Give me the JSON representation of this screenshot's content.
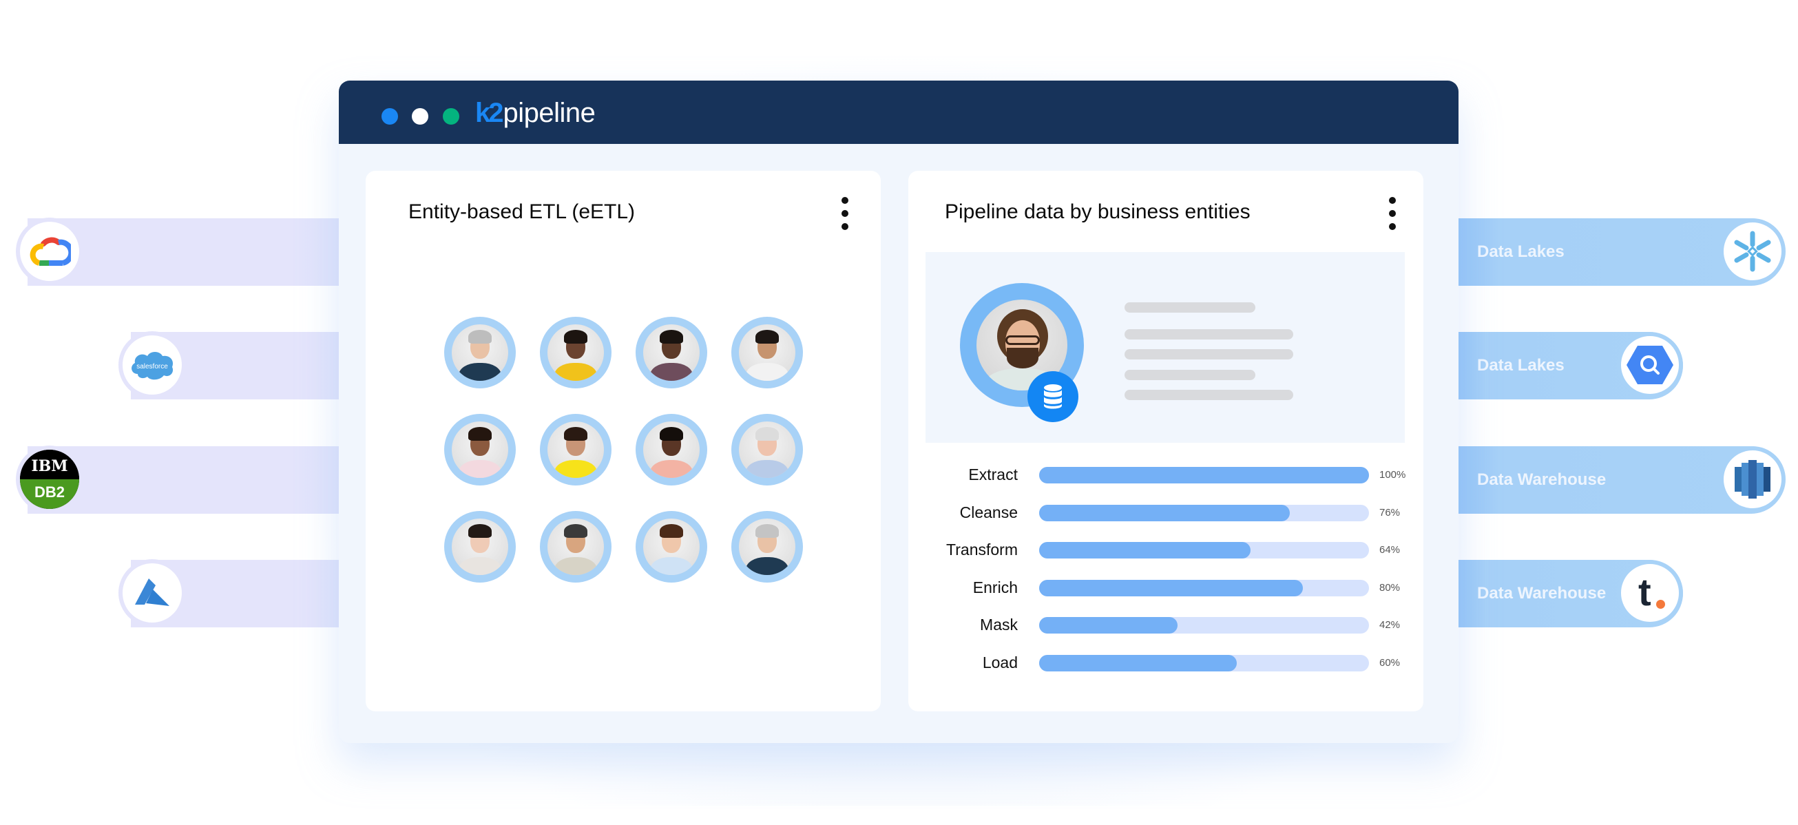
{
  "app": {
    "brand_prefix": "k2",
    "brand_name": "pipeline",
    "window_dots": [
      "blue",
      "white",
      "green"
    ],
    "colors": {
      "header_bg": "#17335a",
      "accent_blue": "#1a87f4",
      "accent_green": "#04b47f",
      "bar_fill": "#74b0f6",
      "bar_track": "#d6e2fd",
      "avatar_ring": "#a8d2f7"
    }
  },
  "sources": [
    {
      "name": "Google Cloud",
      "icon": "google-cloud-icon"
    },
    {
      "name": "Salesforce",
      "icon": "salesforce-icon",
      "logo_text": "salesforce"
    },
    {
      "name": "IBM DB2",
      "icon": "ibm-db2-icon",
      "logo_text_top": "IBM",
      "logo_text_bottom": "DB2"
    },
    {
      "name": "Azure",
      "icon": "azure-icon"
    }
  ],
  "destinations": [
    {
      "label": "Data Lakes",
      "icon": "snowflake-icon"
    },
    {
      "label": "Data Lakes",
      "icon": "bigquery-icon"
    },
    {
      "label": "Data Warehouse",
      "icon": "redshift-icon"
    },
    {
      "label": "Data Warehouse",
      "icon": "teradata-icon",
      "logo_text": "t"
    }
  ],
  "left_panel": {
    "title": "Entity-based ETL (eETL)",
    "menu_icon": "kebab-menu-icon",
    "entities": [
      {
        "name": "entity-1",
        "skin": "#e9c2a6",
        "hair": "#bdbdbd",
        "shirt": "#1f3a52"
      },
      {
        "name": "entity-2",
        "skin": "#6b4330",
        "hair": "#1c1410",
        "shirt": "#f1c21b"
      },
      {
        "name": "entity-3",
        "skin": "#5c3a28",
        "hair": "#1a1410",
        "shirt": "#6e4d5c"
      },
      {
        "name": "entity-4",
        "skin": "#c6946f",
        "hair": "#1d1714",
        "shirt": "#f2f2f2"
      },
      {
        "name": "entity-5",
        "skin": "#8b5a3f",
        "hair": "#24160f",
        "shirt": "#f3d9df"
      },
      {
        "name": "entity-6",
        "skin": "#c89577",
        "hair": "#2a1a12",
        "shirt": "#f7e21a"
      },
      {
        "name": "entity-7",
        "skin": "#5a3626",
        "hair": "#140e0b",
        "shirt": "#f3b3a4"
      },
      {
        "name": "entity-8",
        "skin": "#efc3ad",
        "hair": "#dcdcdc",
        "shirt": "#b8cbe8"
      },
      {
        "name": "entity-9",
        "skin": "#efcbb6",
        "hair": "#231a15",
        "shirt": "#e8e4e0"
      },
      {
        "name": "entity-10",
        "skin": "#d8a57f",
        "hair": "#3a3a3a",
        "shirt": "#d7d3c6"
      },
      {
        "name": "entity-11",
        "skin": "#efc7ab",
        "hair": "#4b2a18",
        "shirt": "#cfe2f5"
      },
      {
        "name": "entity-12",
        "skin": "#e9c2a6",
        "hair": "#c4c4c4",
        "shirt": "#1f3a52"
      }
    ]
  },
  "right_panel": {
    "title": "Pipeline data by business entities",
    "menu_icon": "kebab-menu-icon",
    "profile_badge_icon": "database-icon",
    "stages": [
      {
        "label": "Extract",
        "value": 100,
        "display": "100%"
      },
      {
        "label": "Cleanse",
        "value": 76,
        "display": "76%"
      },
      {
        "label": "Transform",
        "value": 64,
        "display": "64%"
      },
      {
        "label": "Enrich",
        "value": 80,
        "display": "80%"
      },
      {
        "label": "Mask",
        "value": 42,
        "display": "42%"
      },
      {
        "label": "Load",
        "value": 60,
        "display": "60%"
      }
    ]
  }
}
